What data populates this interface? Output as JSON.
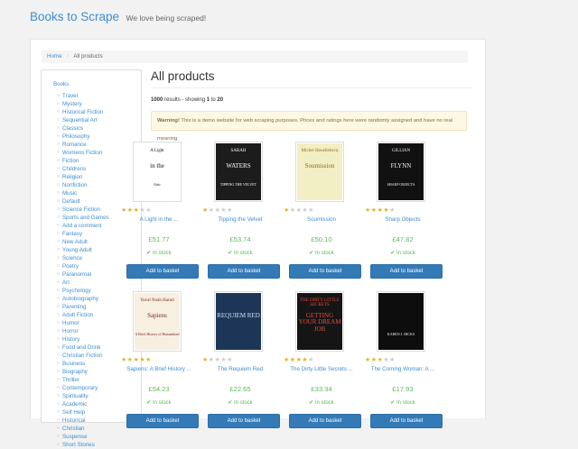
{
  "header": {
    "brand": "Books to Scrape",
    "tagline": "We love being scraped!"
  },
  "breadcrumb": {
    "home": "Home",
    "current": "All products"
  },
  "sidebar": {
    "root": "Books",
    "categories": [
      "Travel",
      "Mystery",
      "Historical Fiction",
      "Sequential Art",
      "Classics",
      "Philosophy",
      "Romance",
      "Womens Fiction",
      "Fiction",
      "Childrens",
      "Religion",
      "Nonfiction",
      "Music",
      "Default",
      "Science Fiction",
      "Sports and Games",
      "Add a comment",
      "Fantasy",
      "New Adult",
      "Young Adult",
      "Science",
      "Poetry",
      "Paranormal",
      "Art",
      "Psychology",
      "Autobiography",
      "Parenting",
      "Adult Fiction",
      "Humor",
      "Horror",
      "History",
      "Food and Drink",
      "Christian Fiction",
      "Business",
      "Biography",
      "Thriller",
      "Contemporary",
      "Spirituality",
      "Academic",
      "Self Help",
      "Historical",
      "Christian",
      "Suspense",
      "Short Stories"
    ]
  },
  "main": {
    "heading": "All products",
    "results_count": "1000",
    "results_mid": " results - showing ",
    "results_from": "1",
    "results_to_word": " to ",
    "results_to": "20",
    "warning_strong": "Warning!",
    "warning_text": " This is a demo website for web scraping purposes. Prices and ratings here were randomly assigned and have no real meaning."
  },
  "products": [
    {
      "title": "A Light in the ...",
      "price": "£51.77",
      "stock": "In stock",
      "rating": 3,
      "button": "Add to basket",
      "cover": {
        "line1": "A Light",
        "line2": "in the",
        "line3": "Attic"
      }
    },
    {
      "title": "Tipping the Velvet",
      "price": "£53.74",
      "stock": "In stock",
      "rating": 1,
      "button": "Add to basket",
      "cover": {
        "line1": "SARAH",
        "line2": "WATERS",
        "line3": "TIPPING THE VELVET"
      }
    },
    {
      "title": "Soumission",
      "price": "£50.10",
      "stock": "In stock",
      "rating": 1,
      "button": "Add to basket",
      "cover": {
        "line1": "Michel Houellebecq",
        "line2": "Soumission",
        "line3": ""
      }
    },
    {
      "title": "Sharp Objects",
      "price": "£47.82",
      "stock": "In stock",
      "rating": 4,
      "button": "Add to basket",
      "cover": {
        "line1": "GILLIAN",
        "line2": "FLYNN",
        "line3": "SHARP OBJECTS"
      }
    },
    {
      "title": "Sapiens: A Brief History ...",
      "price": "£54.23",
      "stock": "In stock",
      "rating": 5,
      "button": "Add to basket",
      "cover": {
        "line1": "Yuval Noah Harari",
        "line2": "Sapiens",
        "line3": "A Brief History of Humankind"
      }
    },
    {
      "title": "The Requiem Red",
      "price": "£22.65",
      "stock": "In stock",
      "rating": 1,
      "button": "Add to basket",
      "cover": {
        "line1": "",
        "line2": "REQUIEM RED",
        "line3": ""
      }
    },
    {
      "title": "The Dirty Little Secrets ...",
      "price": "£33.34",
      "stock": "In stock",
      "rating": 4,
      "button": "Add to basket",
      "cover": {
        "line1": "THE DIRTY LITTLE SECRETS",
        "line2": "GETTING YOUR DREAM JOB",
        "line3": ""
      }
    },
    {
      "title": "The Coming Woman: A ...",
      "price": "£17.93",
      "stock": "In stock",
      "rating": 3,
      "button": "Add to basket",
      "cover": {
        "line1": "",
        "line2": "",
        "line3": "KAREN J. HICKS"
      }
    }
  ],
  "colors": {
    "brand": "#3e8ed0",
    "price": "#5cb85c",
    "button": "#337ab7",
    "star": "#e6b422"
  },
  "icons": {
    "stock": "check-icon",
    "rating": "star-icon"
  }
}
